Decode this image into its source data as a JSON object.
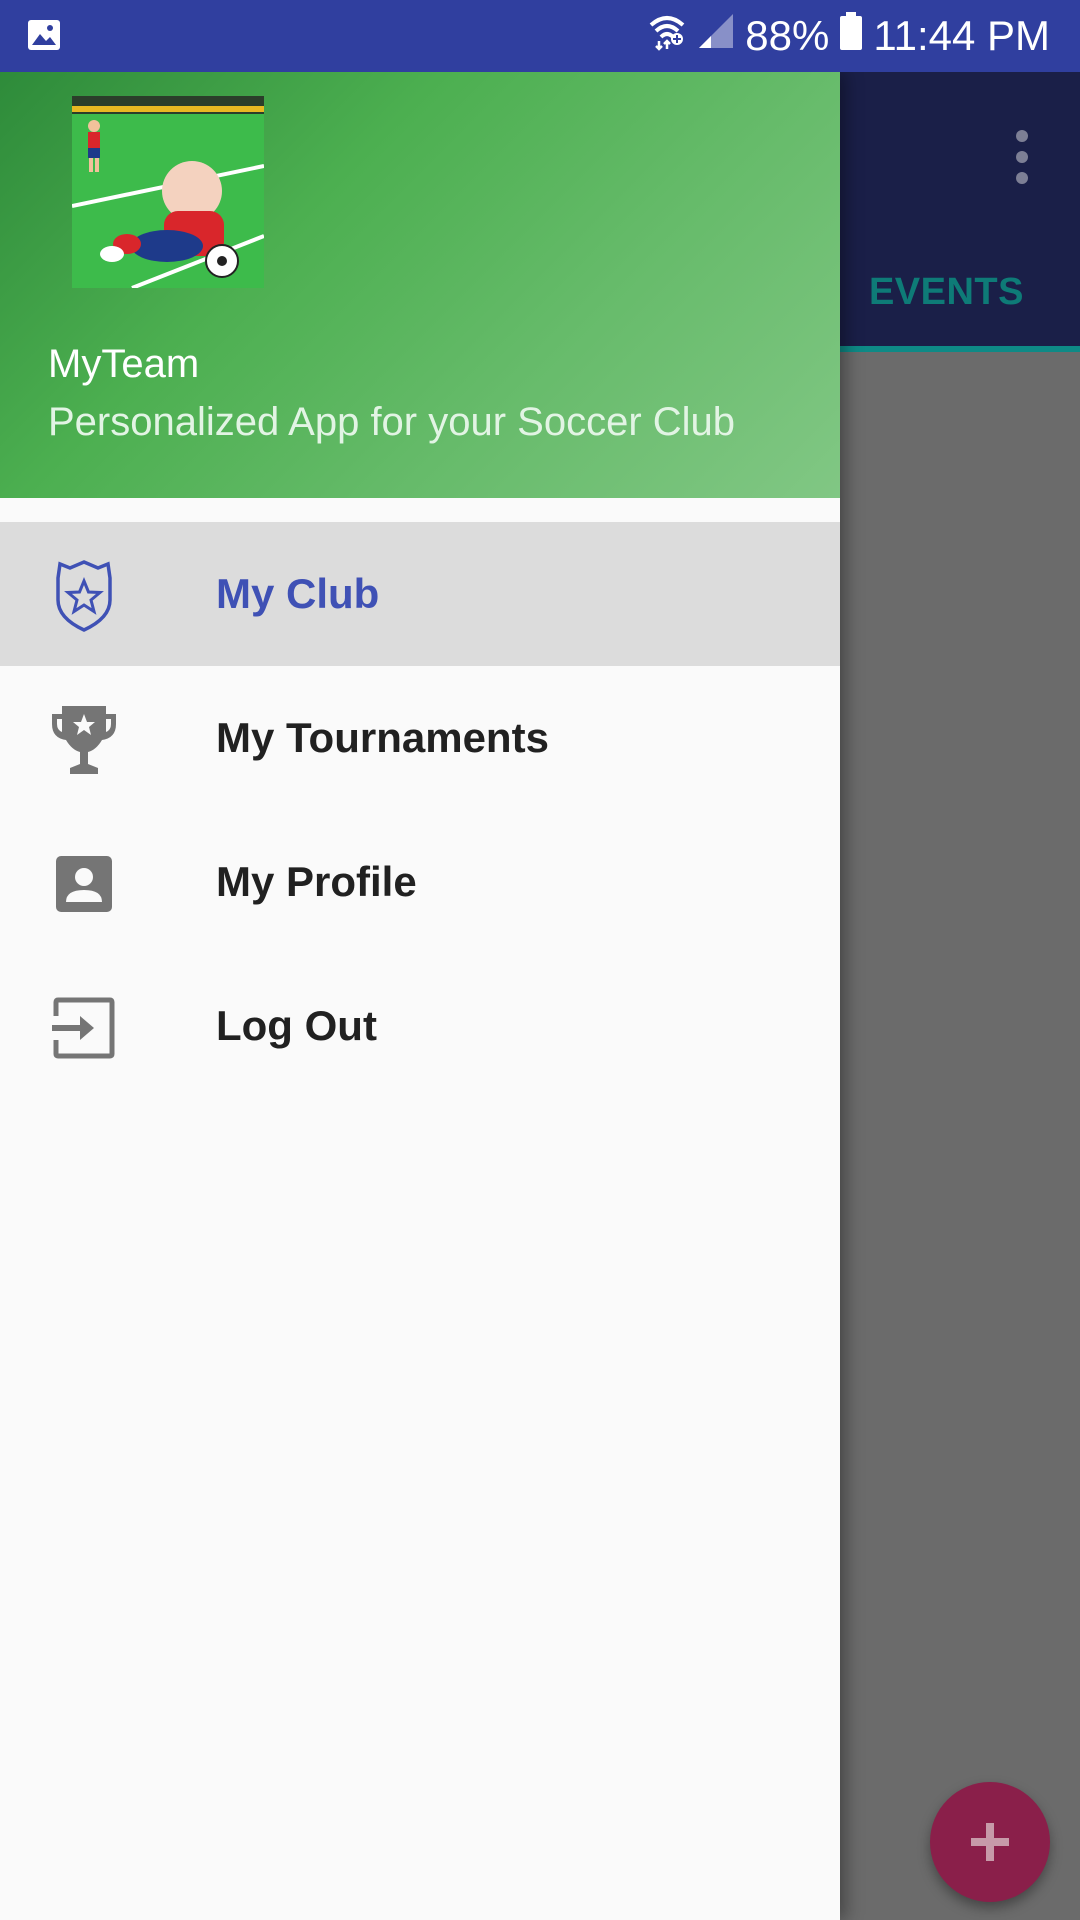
{
  "status_bar": {
    "battery": "88%",
    "time": "11:44 PM",
    "icons": [
      "gallery-notification-icon",
      "wifi-icon",
      "signal-icon",
      "battery-icon"
    ]
  },
  "background_app": {
    "tab_label": "EVENTS",
    "fab_icon": "plus-icon",
    "colors": {
      "toolbar": "#1a1f48",
      "tab_accent": "#0e8a86",
      "fab": "#8a1f4a"
    }
  },
  "drawer": {
    "header": {
      "title": "MyTeam",
      "subtitle": "Personalized App for your Soccer Club"
    },
    "items": [
      {
        "label": "My Club",
        "icon": "shield-star-icon",
        "active": true
      },
      {
        "label": "My Tournaments",
        "icon": "trophy-icon",
        "active": false
      },
      {
        "label": "My Profile",
        "icon": "contact-card-icon",
        "active": false
      },
      {
        "label": "Log Out",
        "icon": "logout-icon",
        "active": false
      }
    ],
    "colors": {
      "active_text": "#3f51b5",
      "header_start": "#2e8b3a",
      "header_end": "#81c784"
    }
  }
}
